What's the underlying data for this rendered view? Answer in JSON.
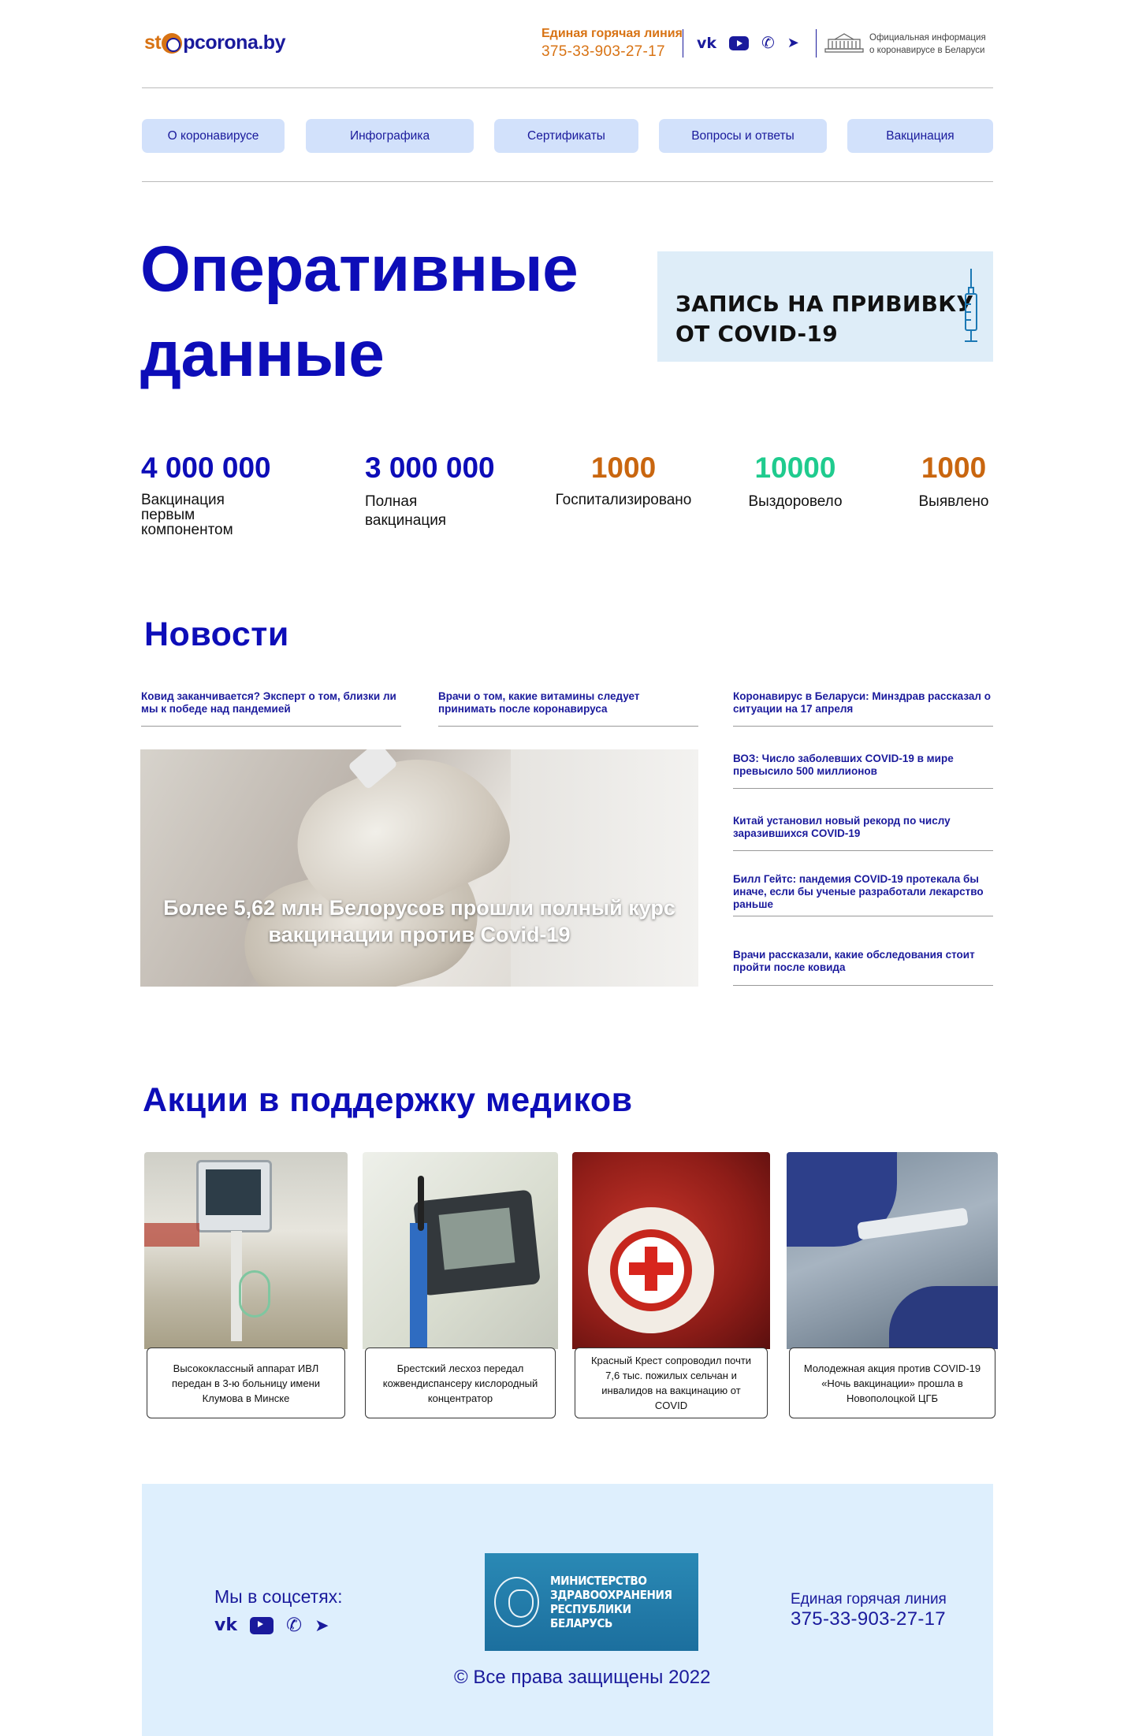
{
  "header": {
    "logo": {
      "part1": "st",
      "part2": "pcorona.by"
    },
    "hotline": {
      "title": "Единая горячая линия",
      "phone": "375-33-903-27-17"
    },
    "official": {
      "line1": "Официальная информация",
      "line2": "о коронавирусе в Беларуси"
    },
    "social": [
      "vk-icon",
      "youtube-icon",
      "viber-icon",
      "telegram-icon"
    ]
  },
  "nav": [
    "О коронавирусе",
    "Инфографика",
    "Сертификаты",
    "Вопросы и ответы",
    "Вакцинация"
  ],
  "hero": {
    "title_line1": "Оперативные",
    "title_line2": "данные",
    "banner_line1": "ЗАПИСЬ НА ПРИВИВКУ",
    "banner_line2": "ОТ COVID-19"
  },
  "stats": [
    {
      "value": "4 000 000",
      "label": "Вакцинация первым компонентом",
      "color": "#0d0db8"
    },
    {
      "value": "3 000 000",
      "label": "Полная вакцинация",
      "color": "#0d0db8"
    },
    {
      "value": "1000",
      "label": "Госпитализировано",
      "color": "#c9660f"
    },
    {
      "value": "10000",
      "label": "Выздоровело",
      "color": "#1fcb8e"
    },
    {
      "value": "1000",
      "label": "Выявлено",
      "color": "#c9660f"
    }
  ],
  "news": {
    "title": "Новости",
    "top": [
      "Ковид заканчивается? Эксперт о том, близки ли мы к победе над пандемией",
      "Врачи о том, какие витамины следует принимать после коронавируса"
    ],
    "feature": "Более 5,62 млн Белорусов прошли полный курс вакцинации против Covid-19",
    "side": [
      "Коронавирус в Беларуси: Минздрав рассказал о ситуации на 17 апреля",
      "ВОЗ: Число заболевших COVID-19 в мире превысило 500 миллионов",
      "Китай установил новый рекорд по числу заразившихся COVID-19",
      "Билл Гейтс: пандемия COVID-19 протекала бы иначе, если бы ученые разработали лекарство раньше",
      "Врачи рассказали, какие обследования стоит пройти после ковида"
    ]
  },
  "actions": {
    "title": "Акции в поддержку медиков",
    "cards": [
      "Высококлассный аппарат ИВЛ передан в 3-ю больницу имени Клумова в Минске",
      "Брестский лесхоз передал кожвендиспансеру кислородный концентратор",
      "Красный Крест сопроводил почти 7,6 тыс. пожилых сельчан и инвалидов на вакцинацию от COVID",
      "Молодежная акция против COVID-19 «Ночь вакцинации» прошла в Новополоцкой ЦГБ"
    ]
  },
  "footer": {
    "social_title": "Мы в соцсетях:",
    "ministry": [
      "МИНИСТЕРСТВО",
      "ЗДРАВООХРАНЕНИЯ",
      "РЕСПУБЛИКИ БЕЛАРУСЬ"
    ],
    "hotline_title": "Единая горячая линия",
    "hotline_phone": "375-33-903-27-17",
    "copyright": "© Все права защищены 2022"
  },
  "colors": {
    "brand": "#1a1a9c",
    "accent": "#d87314",
    "nav_bg": "#d2e1fb",
    "footer_bg": "#deeffd"
  }
}
